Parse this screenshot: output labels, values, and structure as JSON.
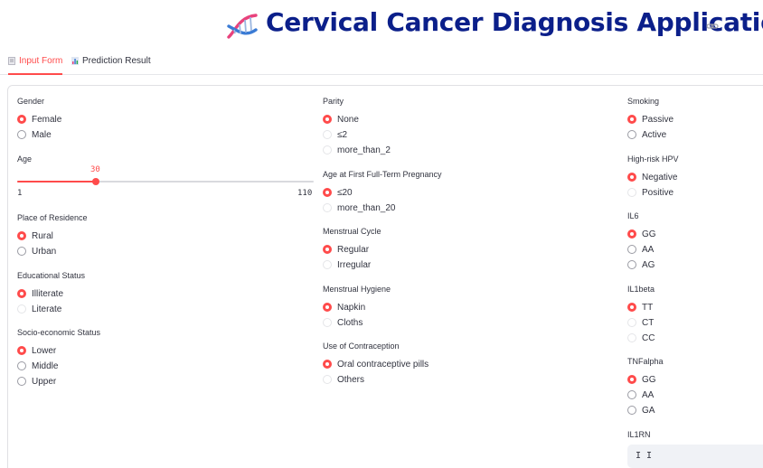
{
  "header": {
    "title": "Cervical Cancer Diagnosis Application"
  },
  "tabs": [
    {
      "label": "Input Form",
      "active": true
    },
    {
      "label": "Prediction Result",
      "active": false
    }
  ],
  "form": {
    "gender": {
      "label": "Gender",
      "options": [
        "Female",
        "Male"
      ],
      "selected": "Female"
    },
    "age": {
      "label": "Age",
      "value": "30",
      "min": "1",
      "max": "110"
    },
    "residence": {
      "label": "Place of Residence",
      "options": [
        "Rural",
        "Urban"
      ],
      "selected": "Rural"
    },
    "education": {
      "label": "Educational Status",
      "options": [
        "Illiterate",
        "Literate"
      ],
      "selected": "Illiterate"
    },
    "socio": {
      "label": "Socio-economic Status",
      "options": [
        "Lower",
        "Middle",
        "Upper"
      ],
      "selected": "Lower"
    },
    "parity": {
      "label": "Parity",
      "options": [
        "None",
        "≤2",
        "more_than_2"
      ],
      "selected": "None"
    },
    "first_pregnancy": {
      "label": "Age at First Full-Term Pregnancy",
      "options": [
        "≤20",
        "more_than_20"
      ],
      "selected": "≤20"
    },
    "menstrual_cycle": {
      "label": "Menstrual Cycle",
      "options": [
        "Regular",
        "Irregular"
      ],
      "selected": "Regular"
    },
    "menstrual_hygiene": {
      "label": "Menstrual Hygiene",
      "options": [
        "Napkin",
        "Cloths"
      ],
      "selected": "Napkin"
    },
    "contraception": {
      "label": "Use of Contraception",
      "options": [
        "Oral contraceptive pills",
        "Others"
      ],
      "selected": "Oral contraceptive pills"
    },
    "smoking": {
      "label": "Smoking",
      "options": [
        "Passive",
        "Active"
      ],
      "selected": "Passive"
    },
    "hpv": {
      "label": "High-risk HPV",
      "options": [
        "Negative",
        "Positive"
      ],
      "selected": "Negative"
    },
    "il6": {
      "label": "IL6",
      "options": [
        "GG",
        "AA",
        "AG"
      ],
      "selected": "GG"
    },
    "il1beta": {
      "label": "IL1beta",
      "options": [
        "TT",
        "CT",
        "CC"
      ],
      "selected": "TT"
    },
    "tnfalpha": {
      "label": "TNFalpha",
      "options": [
        "GG",
        "AA",
        "GA"
      ],
      "selected": "GG"
    },
    "il1rn": {
      "label": "IL1RN",
      "value": "I I"
    }
  },
  "colors": {
    "accent": "#ff4b4b",
    "title": "#0b1f8a"
  }
}
